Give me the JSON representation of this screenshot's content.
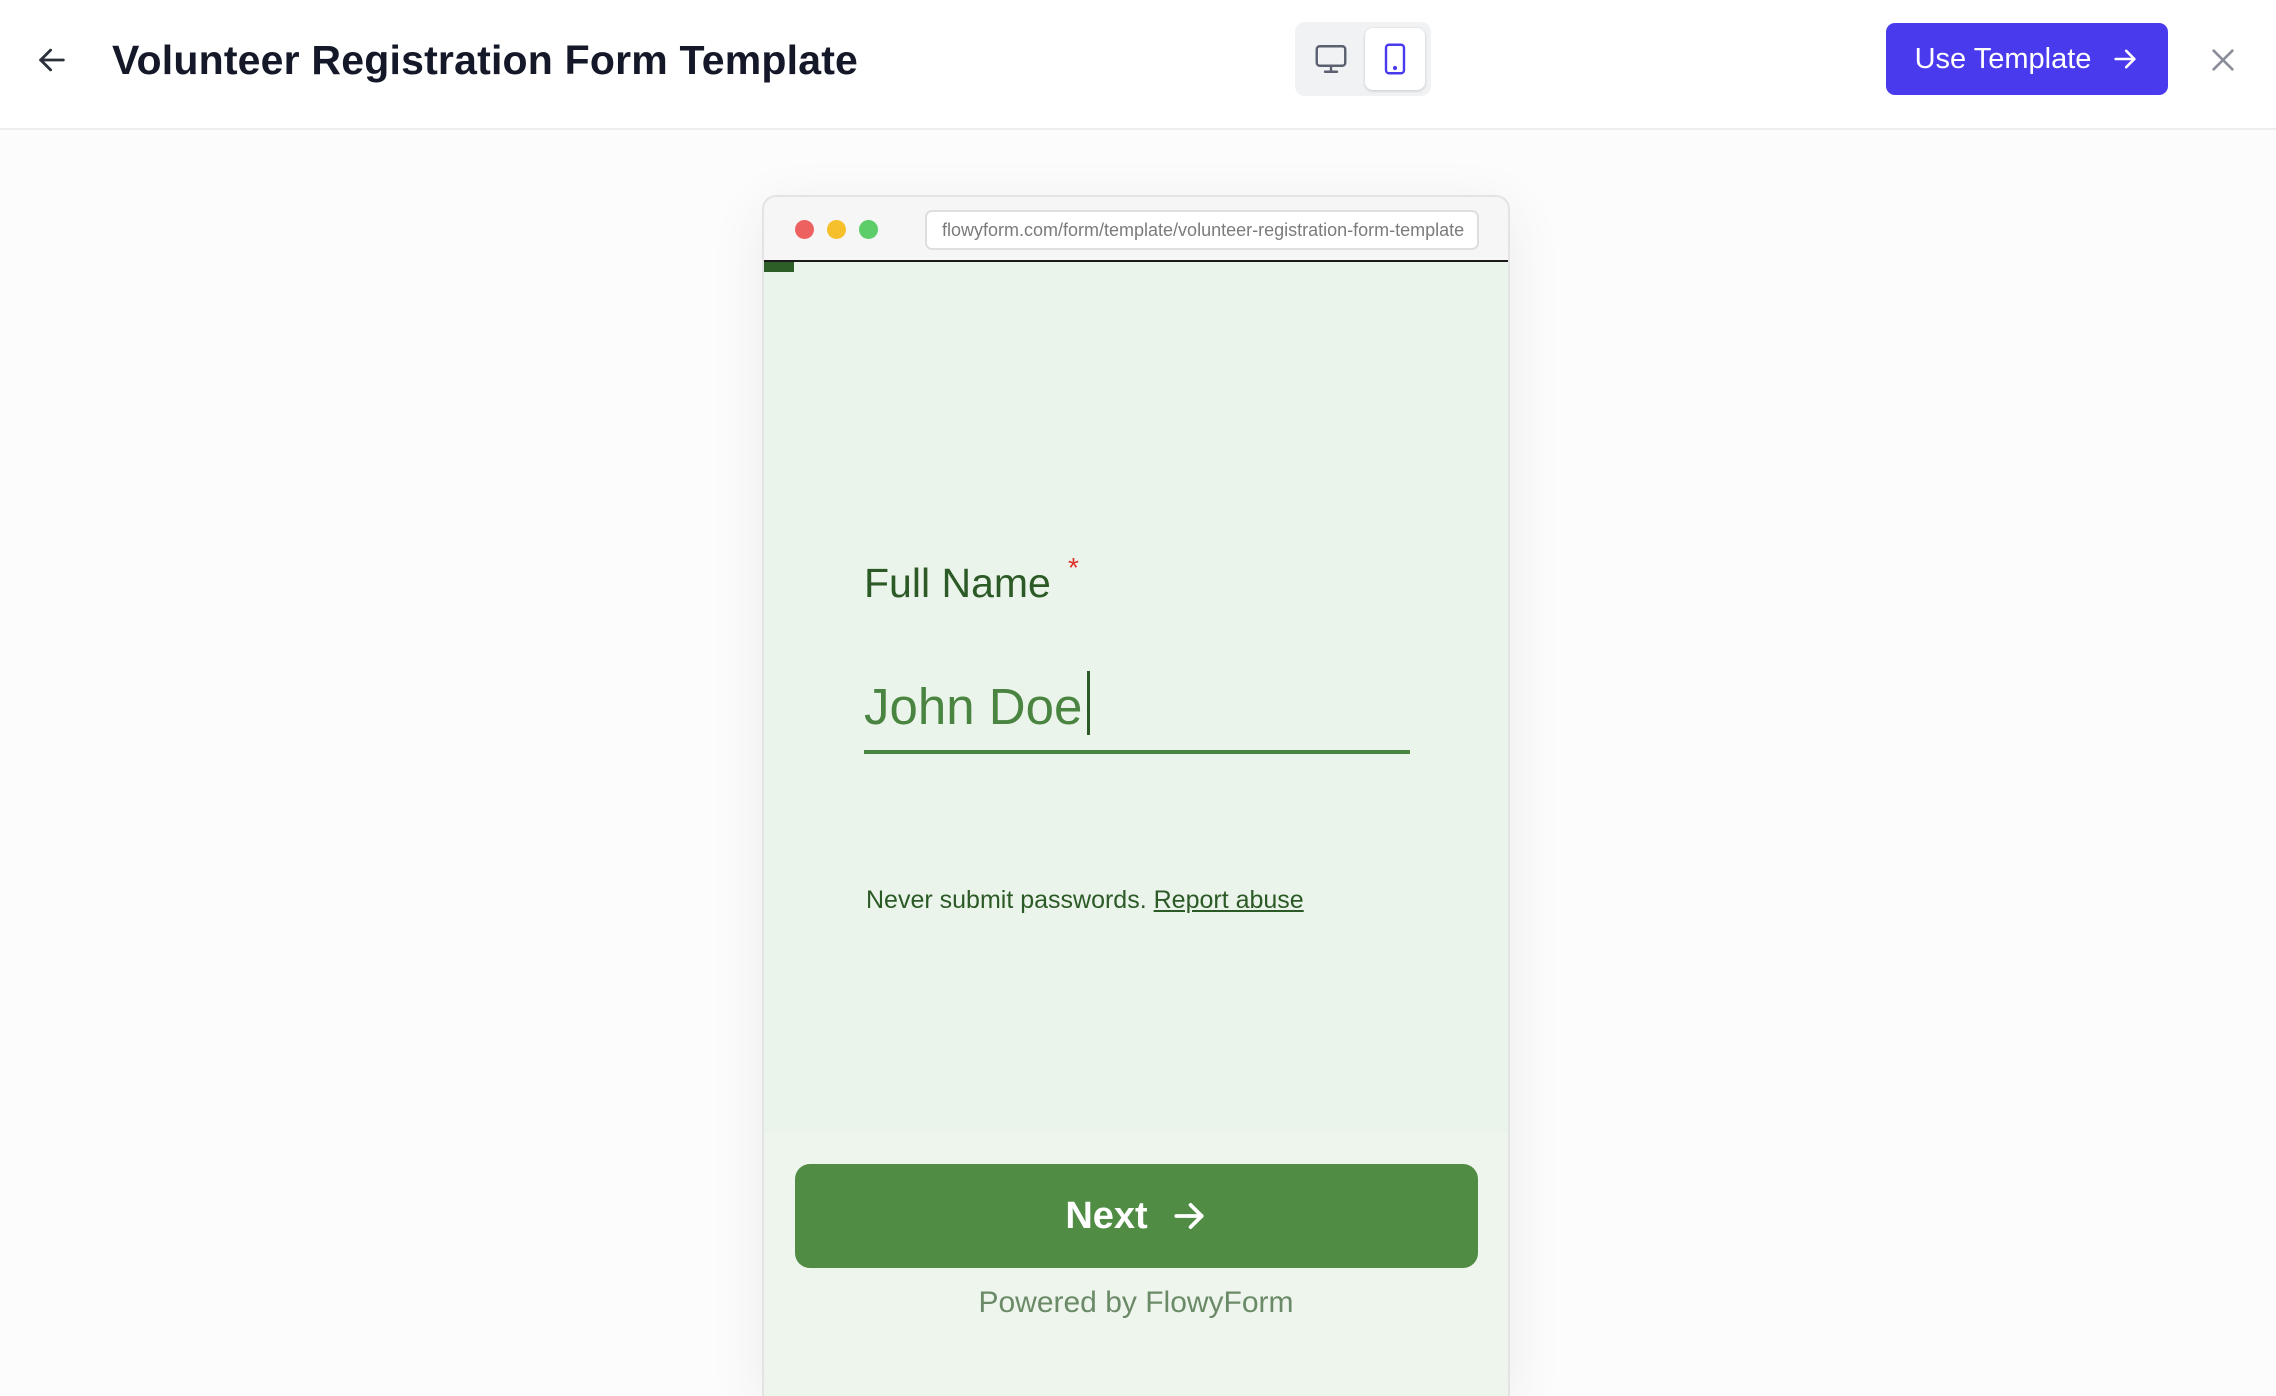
{
  "header": {
    "title": "Volunteer Registration Form Template",
    "use_template_label": "Use Template",
    "icons": {
      "back": "arrow-left-icon",
      "desktop": "monitor-icon",
      "mobile": "smartphone-icon",
      "use_template": "arrow-right-icon",
      "close": "close-icon"
    },
    "device_selected": "mobile",
    "accent_color": "#4a3aee"
  },
  "preview": {
    "url": "flowyform.com/form/template/volunteer-registration-form-template",
    "field": {
      "label": "Full Name",
      "required_mark": "*",
      "value": "John Doe"
    },
    "notice": {
      "text": "Never submit passwords.",
      "link": "Report abuse"
    },
    "next_label": "Next",
    "powered_by": "Powered by FlowyForm",
    "colors": {
      "background": "#ebf4ea",
      "primary": "#518c45",
      "text": "#2c5a26"
    }
  }
}
